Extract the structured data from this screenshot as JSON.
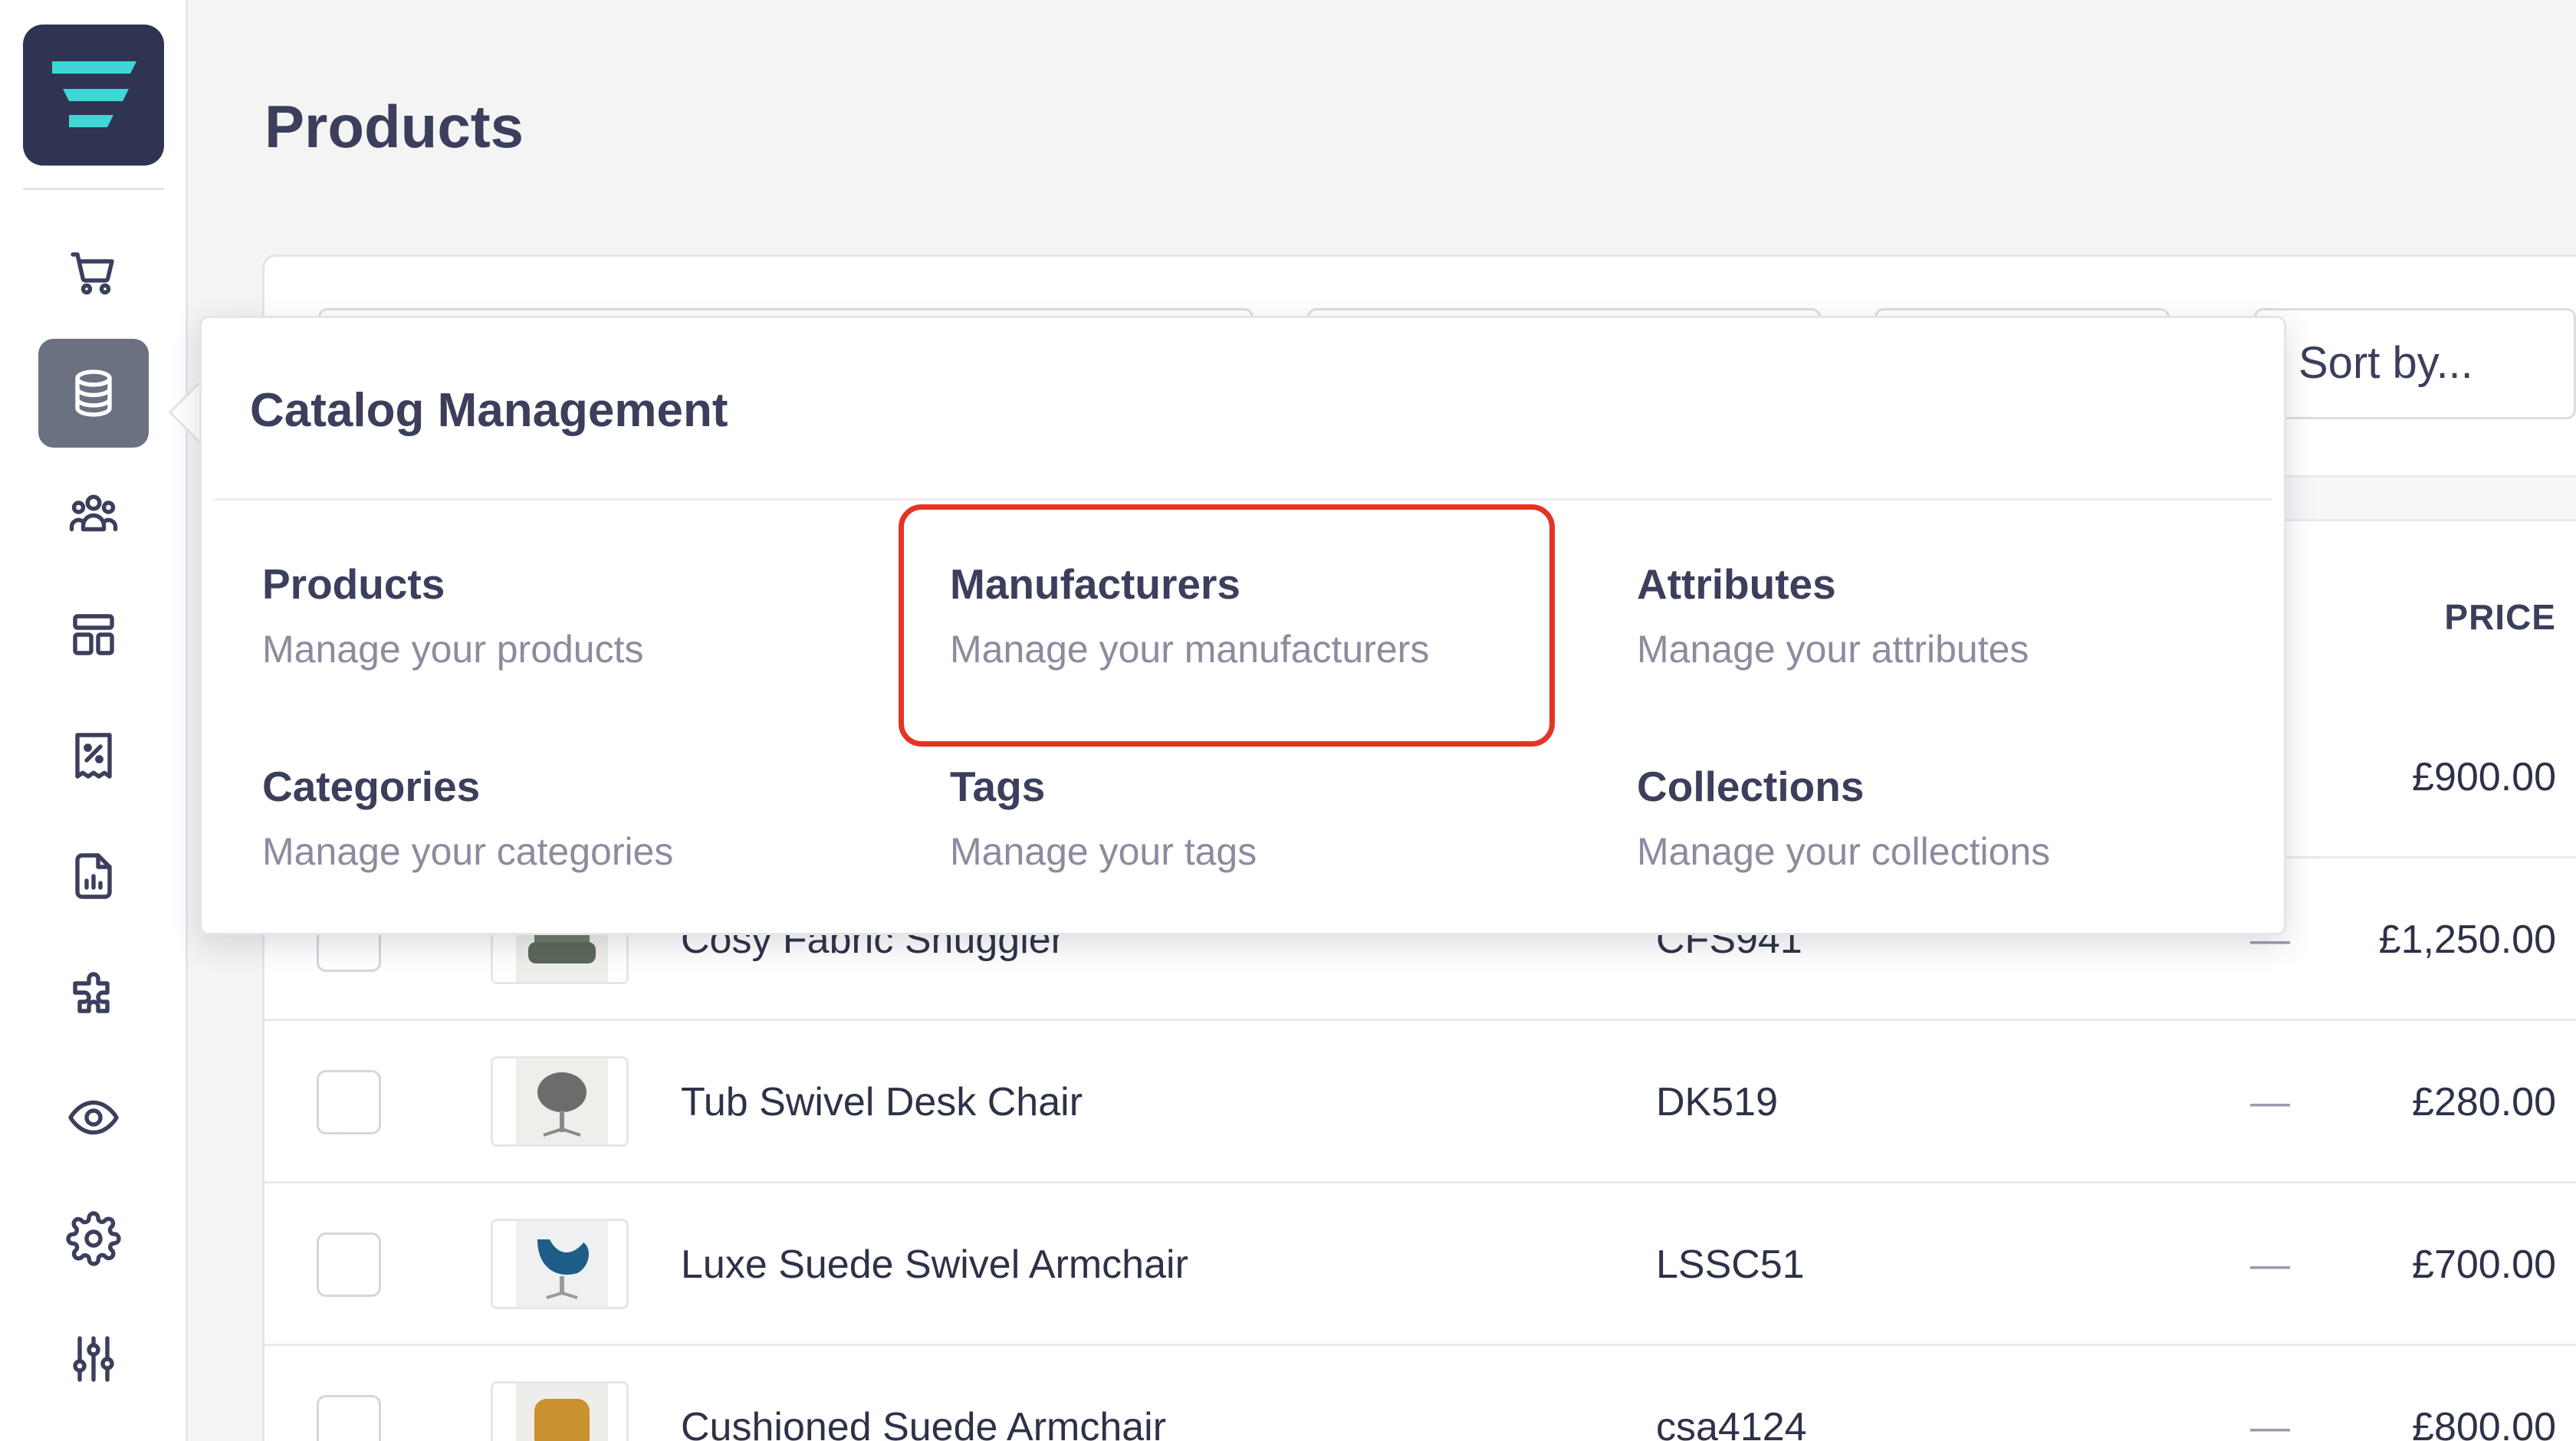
{
  "page": {
    "title": "Products"
  },
  "sidebar": {
    "items": [
      {
        "icon": "cart-icon",
        "active": false
      },
      {
        "icon": "database-icon",
        "active": true
      },
      {
        "icon": "users-icon",
        "active": false
      },
      {
        "icon": "layout-icon",
        "active": false
      },
      {
        "icon": "discount-icon",
        "active": false
      },
      {
        "icon": "report-icon",
        "active": false
      },
      {
        "icon": "puzzle-icon",
        "active": false
      },
      {
        "icon": "eye-icon",
        "active": false
      },
      {
        "icon": "settings-icon",
        "active": false
      },
      {
        "icon": "sliders-icon",
        "active": false
      }
    ]
  },
  "toolbar": {
    "sort_label": "Sort by..."
  },
  "table": {
    "price_header": "PRICE",
    "rows": [
      {
        "name": "",
        "sku": "",
        "dash": "",
        "price": "£900.00"
      },
      {
        "name": "Cosy Fabric Snuggler",
        "sku": "CFS941",
        "dash": "—",
        "price": "£1,250.00"
      },
      {
        "name": "Tub Swivel Desk Chair",
        "sku": "DK519",
        "dash": "—",
        "price": "£280.00"
      },
      {
        "name": "Luxe Suede Swivel Armchair",
        "sku": "LSSC51",
        "dash": "—",
        "price": "£700.00"
      },
      {
        "name": "Cushioned Suede Armchair",
        "sku": "csa4124",
        "dash": "—",
        "price": "£800.00"
      }
    ]
  },
  "popover": {
    "title": "Catalog Management",
    "items": [
      {
        "title": "Products",
        "desc": "Manage your products"
      },
      {
        "title": "Manufacturers",
        "desc": "Manage your manufacturers"
      },
      {
        "title": "Attributes",
        "desc": "Manage your attributes"
      },
      {
        "title": "Categories",
        "desc": "Manage your categories"
      },
      {
        "title": "Tags",
        "desc": "Manage your tags"
      },
      {
        "title": "Collections",
        "desc": "Manage your collections"
      }
    ]
  },
  "colors": {
    "logo_bg": "#2f3452",
    "logo_accent": "#3fd7d5",
    "active_nav": "#6b7180",
    "highlight": "#e53324"
  }
}
